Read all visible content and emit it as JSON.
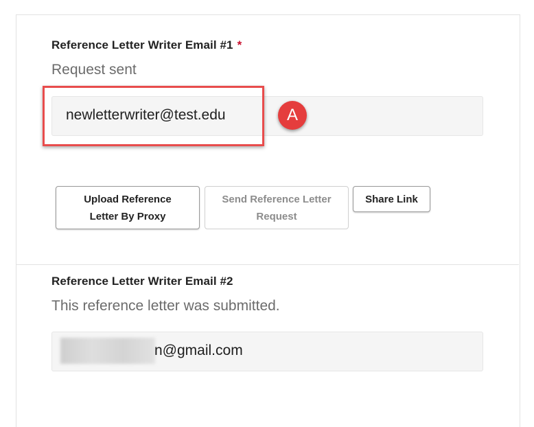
{
  "ref1": {
    "label": "Reference Letter Writer Email #1",
    "required_mark": "*",
    "status": "Request sent",
    "email_value": "newletterwriter@test.edu",
    "callout": "A"
  },
  "buttons": {
    "upload_proxy": "Upload Reference Letter By Proxy",
    "send_request": "Send Reference Letter Request",
    "share_link": "Share Link"
  },
  "ref2": {
    "label": "Reference Letter Writer Email #2",
    "status": "This reference letter was submitted.",
    "email_value_visible": "n@gmail.com"
  },
  "colors": {
    "required": "#c8102e",
    "highlight": "#e84c4c",
    "field_bg": "#f5f5f5"
  }
}
